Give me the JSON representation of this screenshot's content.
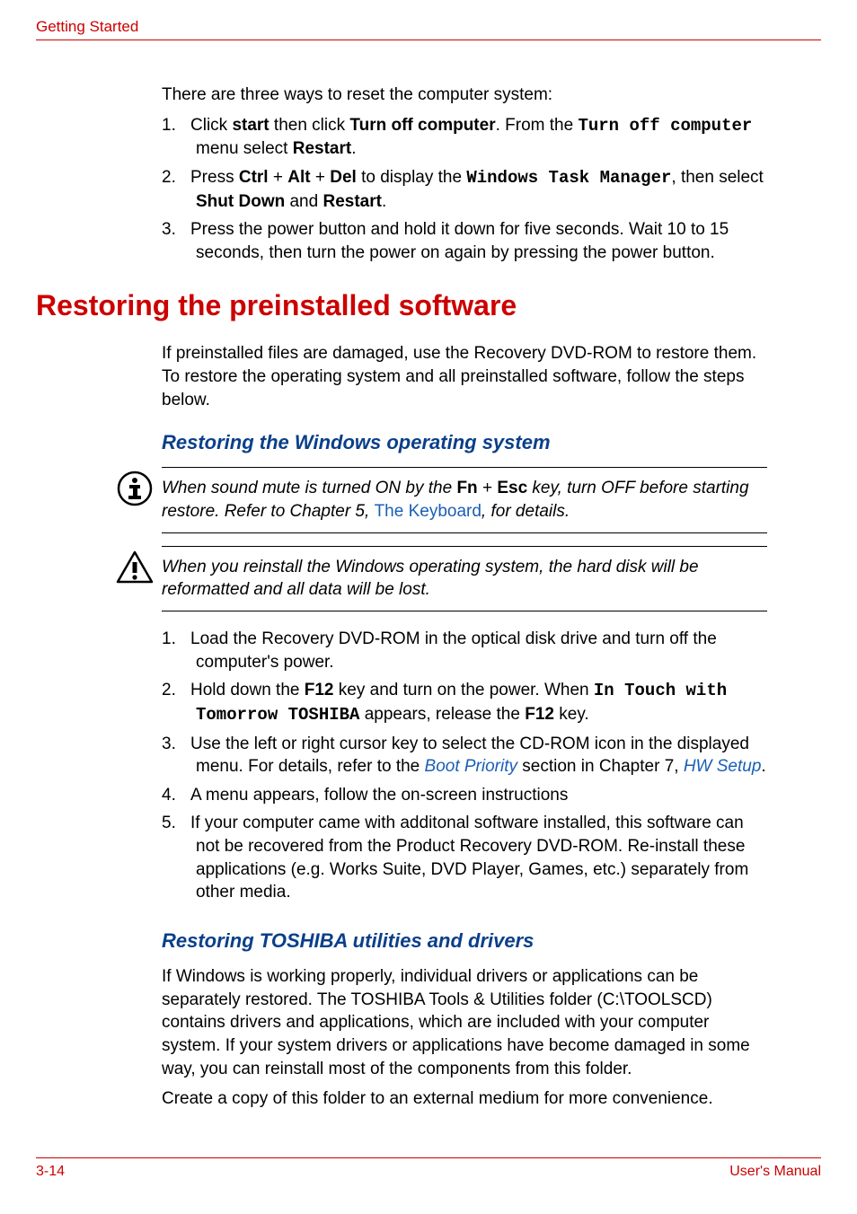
{
  "header": {
    "label": "Getting Started"
  },
  "intro": "There are three ways to reset the computer system:",
  "reset_list": {
    "n1": "1.",
    "n2": "2.",
    "n3": "3.",
    "i1_a": "Click ",
    "i1_b": "start",
    "i1_c": " then click ",
    "i1_d": "Turn off computer",
    "i1_e": ". From the ",
    "i1_f": "Turn off computer",
    "i1_g": "  menu select ",
    "i1_h": "Restart",
    "i1_i": ".",
    "i2_a": "Press ",
    "i2_b": "Ctrl",
    "i2_c": " + ",
    "i2_d": "Alt",
    "i2_e": " + ",
    "i2_f": "Del",
    "i2_g": " to display the ",
    "i2_h": "Windows Task Manager",
    "i2_i": ", then select ",
    "i2_j": "Shut Down",
    "i2_k": " and ",
    "i2_l": "Restart",
    "i2_m": ".",
    "i3": "Press the power button and hold it down for five seconds. Wait 10 to 15 seconds, then turn the power on again by pressing the power button."
  },
  "section_title": "Restoring the preinstalled software",
  "section_intro": "If preinstalled files are damaged, use the Recovery DVD-ROM to restore them. To restore the operating system and all preinstalled software, follow the steps below.",
  "sub1_title": "Restoring the Windows operating system",
  "note1": {
    "a": "When sound mute is turned ON by the ",
    "b": "Fn",
    "c": " + ",
    "d": "Esc",
    "e": " key, turn OFF before starting restore. Refer to Chapter 5, ",
    "f": "The Keyboard",
    "g": ", for details."
  },
  "note2": "When you reinstall the Windows operating system, the hard disk will be reformatted and all data will be lost.",
  "steps": {
    "n1": "1.",
    "n2": "2.",
    "n3": "3.",
    "n4": "4.",
    "n5": "5.",
    "s1": "Load the Recovery DVD-ROM in the optical disk drive and turn off the computer's power.",
    "s2_a": "Hold down the ",
    "s2_b": "F12",
    "s2_c": " key and turn on the power. When ",
    "s2_d": "In Touch with Tomorrow TOSHIBA",
    "s2_e": " appears, release the ",
    "s2_f": "F12",
    "s2_g": " key.",
    "s3_a": "Use the left or right cursor key to select the CD-ROM icon in the displayed menu. For details, refer to the ",
    "s3_b": "Boot Priority",
    "s3_c": " section in Chapter 7, ",
    "s3_d": "HW Setup",
    "s3_e": ".",
    "s4": "A menu appears, follow the on-screen instructions",
    "s5": "If your computer came with additonal software installed, this software can not be recovered from the Product Recovery DVD-ROM. Re-install these applications (e.g. Works Suite, DVD Player, Games, etc.) separately from other media."
  },
  "sub2_title": "Restoring TOSHIBA utilities and drivers",
  "sub2_p1": "If Windows is working properly, individual drivers or applications can be separately restored. The TOSHIBA Tools & Utilities folder (C:\\TOOLSCD) contains drivers and applications, which are included with your computer system. If your system drivers or applications have become damaged in some way, you can reinstall most of the components from this folder.",
  "sub2_p2": "Create a copy of this folder to an external medium for more convenience.",
  "footer": {
    "page": "3-14",
    "manual": "User's Manual"
  }
}
